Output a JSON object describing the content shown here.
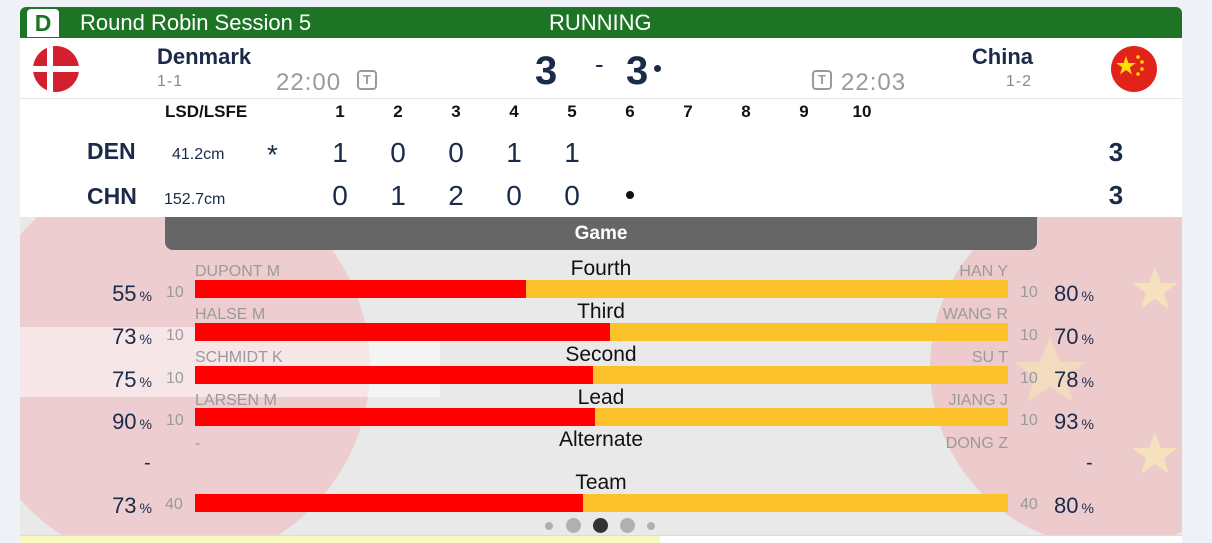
{
  "header": {
    "sheet": "D",
    "session": "Round Robin Session 5",
    "status": "RUNNING"
  },
  "teams": {
    "left": {
      "name": "Denmark",
      "record": "1-1",
      "clock": "22:00",
      "timeout_icon": "T",
      "score": "3",
      "abbr": "DEN",
      "lsd": "41.2cm",
      "total": "3",
      "mark": "*"
    },
    "right": {
      "name": "China",
      "record": "1-2",
      "clock": "22:03",
      "timeout_icon": "T",
      "score": "3",
      "abbr": "CHN",
      "lsd": "152.7cm",
      "total": "3"
    }
  },
  "score_sep": "-",
  "linescore": {
    "lsd_header": "LSD/LSFE",
    "ends": [
      "1",
      "2",
      "3",
      "4",
      "5",
      "6",
      "7",
      "8",
      "9",
      "10"
    ],
    "den": [
      "1",
      "0",
      "0",
      "1",
      "1"
    ],
    "chn": [
      "0",
      "1",
      "2",
      "0",
      "0"
    ]
  },
  "game_tab": "Game",
  "positions": [
    {
      "label": "Fourth",
      "left_name": "DUPONT M",
      "right_name": "HAN Y",
      "left_pct": "55",
      "right_pct": "80",
      "left_shots": "10",
      "right_shots": "10",
      "left_fraction": 0.407
    },
    {
      "label": "Third",
      "left_name": "HALSE M",
      "right_name": "WANG R",
      "left_pct": "73",
      "right_pct": "70",
      "left_shots": "10",
      "right_shots": "10",
      "left_fraction": 0.511
    },
    {
      "label": "Second",
      "left_name": "SCHMIDT K",
      "right_name": "SU T",
      "left_pct": "75",
      "right_pct": "78",
      "left_shots": "10",
      "right_shots": "10",
      "left_fraction": 0.49
    },
    {
      "label": "Lead",
      "left_name": "LARSEN M",
      "right_name": "JIANG J",
      "left_pct": "90",
      "right_pct": "93",
      "left_shots": "10",
      "right_shots": "10",
      "left_fraction": 0.492
    }
  ],
  "alternate": {
    "label": "Alternate",
    "left_name": "-",
    "right_name": "DONG Z",
    "left_value": "-",
    "right_value": "-"
  },
  "team": {
    "label": "Team",
    "left_pct": "73",
    "right_pct": "80",
    "left_shots": "40",
    "right_shots": "40",
    "left_fraction": 0.477
  },
  "pct_unit": "%",
  "colors": {
    "header_green": "#1e7425",
    "left_bar": "#ff0000",
    "right_bar": "#fcc22c",
    "text_navy": "#1a2b4a"
  },
  "pagination": {
    "count": 5,
    "active": 2
  }
}
